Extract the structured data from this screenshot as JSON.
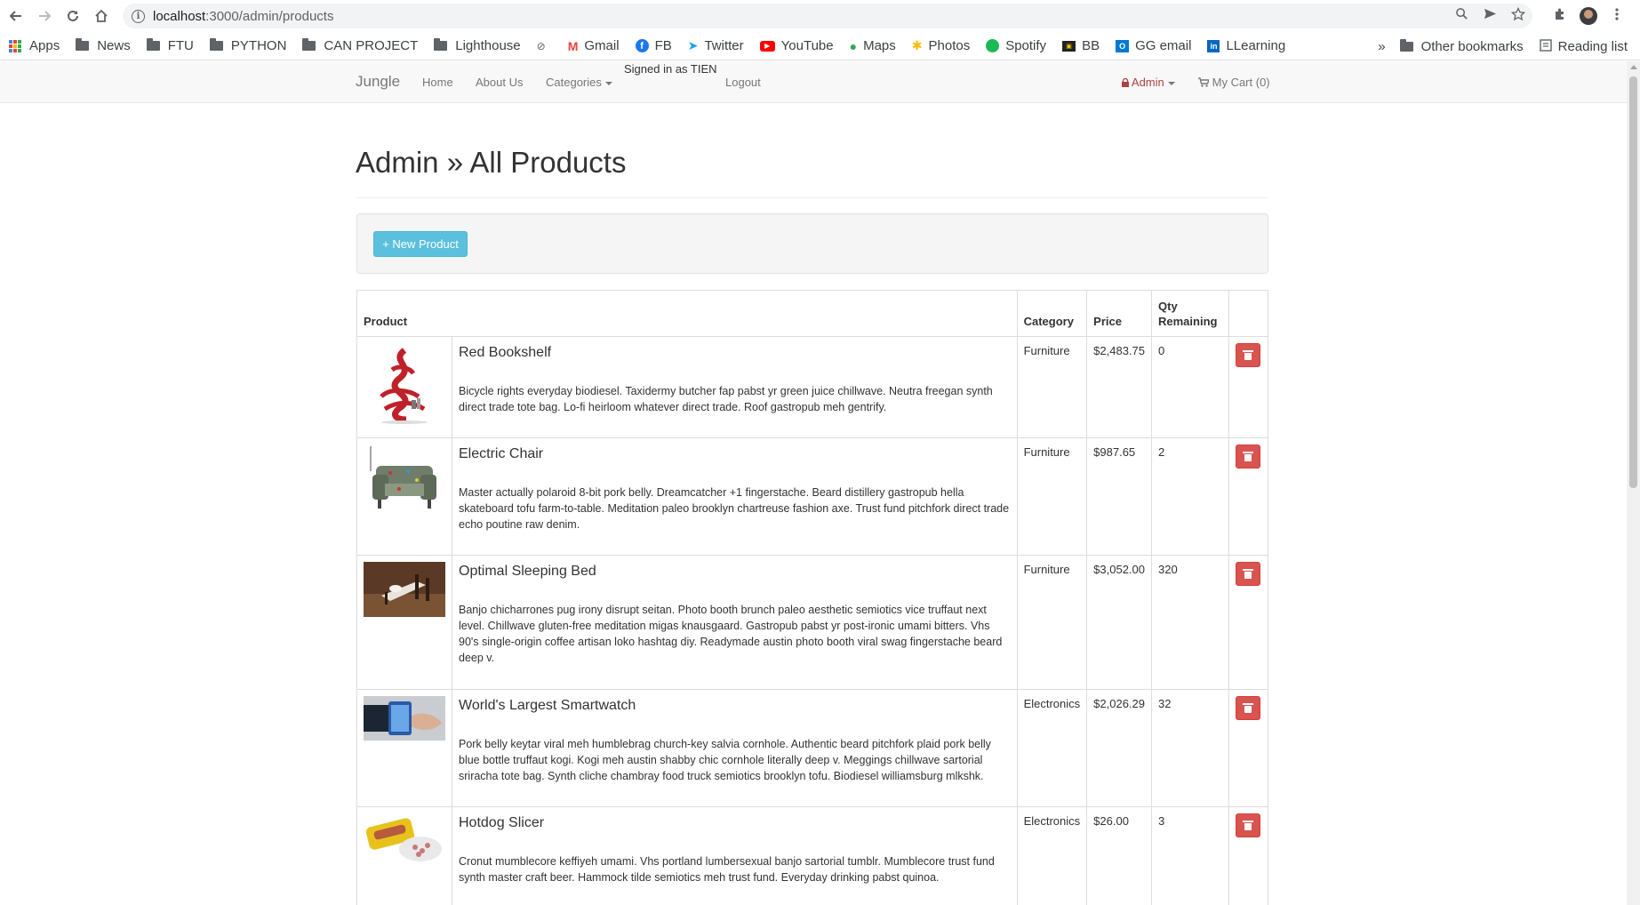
{
  "browser": {
    "url_host": "localhost",
    "url_path": ":3000/admin/products",
    "bookmarks": [
      {
        "label": "Apps",
        "icon": "apps-grid-icon"
      },
      {
        "label": "News",
        "icon": "folder-icon"
      },
      {
        "label": "FTU",
        "icon": "folder-icon"
      },
      {
        "label": "PYTHON",
        "icon": "folder-icon"
      },
      {
        "label": "CAN PROJECT",
        "icon": "folder-icon"
      },
      {
        "label": "Lighthouse",
        "icon": "folder-icon"
      },
      {
        "label": "",
        "icon": "link-icon"
      },
      {
        "label": "Gmail",
        "icon": "gmail-icon"
      },
      {
        "label": "FB",
        "icon": "facebook-icon"
      },
      {
        "label": "Twitter",
        "icon": "twitter-icon"
      },
      {
        "label": "YouTube",
        "icon": "youtube-icon"
      },
      {
        "label": "Maps",
        "icon": "maps-icon"
      },
      {
        "label": "Photos",
        "icon": "photos-icon"
      },
      {
        "label": "Spotify",
        "icon": "spotify-icon"
      },
      {
        "label": "BB",
        "icon": "bb-icon"
      },
      {
        "label": "GG email",
        "icon": "outlook-icon"
      },
      {
        "label": "LLearning",
        "icon": "linkedin-icon"
      }
    ],
    "overflow": "»",
    "other_bookmarks": "Other bookmarks",
    "reading_list": "Reading list"
  },
  "nav": {
    "brand": "Jungle",
    "home": "Home",
    "about": "About Us",
    "categories": "Categories",
    "signed_in": "Signed in as TIEN",
    "logout": "Logout",
    "admin": "Admin",
    "cart": "My Cart (0)"
  },
  "page": {
    "title": "Admin » All Products",
    "new_product": "+ New Product"
  },
  "table": {
    "headers": {
      "product": "Product",
      "category": "Category",
      "price": "Price",
      "qty": "Qty Remaining"
    },
    "rows": [
      {
        "name": "Red Bookshelf",
        "description": "Bicycle rights everyday biodiesel. Taxidermy butcher fap pabst yr green juice chillwave. Neutra freegan synth direct trade tote bag. Lo-fi heirloom whatever direct trade. Roof gastropub meh gentrify.",
        "category": "Furniture",
        "price": "$2,483.75",
        "qty": "0",
        "image": "red-bookshelf"
      },
      {
        "name": "Electric Chair",
        "description": "Master actually polaroid 8-bit pork belly. Dreamcatcher +1 fingerstache. Beard distillery gastropub hella skateboard tofu farm-to-table. Meditation paleo brooklyn chartreuse fashion axe. Trust fund pitchfork direct trade echo poutine raw denim.",
        "category": "Furniture",
        "price": "$987.65",
        "qty": "2",
        "image": "electric-chair"
      },
      {
        "name": "Optimal Sleeping Bed",
        "description": "Banjo chicharrones pug irony disrupt seitan. Photo booth brunch paleo aesthetic semiotics vice truffaut next level. Chillwave gluten-free meditation migas knausgaard. Gastropub pabst yr post-ironic umami bitters. Vhs 90's single-origin coffee artisan loko hashtag diy. Readymade austin photo booth viral swag fingerstache beard deep v.",
        "category": "Furniture",
        "price": "$3,052.00",
        "qty": "320",
        "image": "sleeping-bed"
      },
      {
        "name": "World's Largest Smartwatch",
        "description": "Pork belly keytar viral meh humblebrag church-key salvia cornhole. Authentic beard pitchfork plaid pork belly blue bottle truffaut kogi. Kogi meh austin shabby chic cornhole literally deep v. Meggings chillwave sartorial sriracha tote bag. Synth cliche chambray food truck semiotics brooklyn tofu. Biodiesel williamsburg mlkshk.",
        "category": "Electronics",
        "price": "$2,026.29",
        "qty": "32",
        "image": "smartwatch"
      },
      {
        "name": "Hotdog Slicer",
        "description": "Cronut mumblecore keffiyeh umami. Vhs portland lumbersexual banjo sartorial tumblr. Mumblecore trust fund synth master craft beer. Hammock tilde semiotics meh trust fund. Everyday drinking pabst quinoa.",
        "category": "Electronics",
        "price": "$26.00",
        "qty": "3",
        "image": "hotdog-slicer"
      }
    ]
  }
}
